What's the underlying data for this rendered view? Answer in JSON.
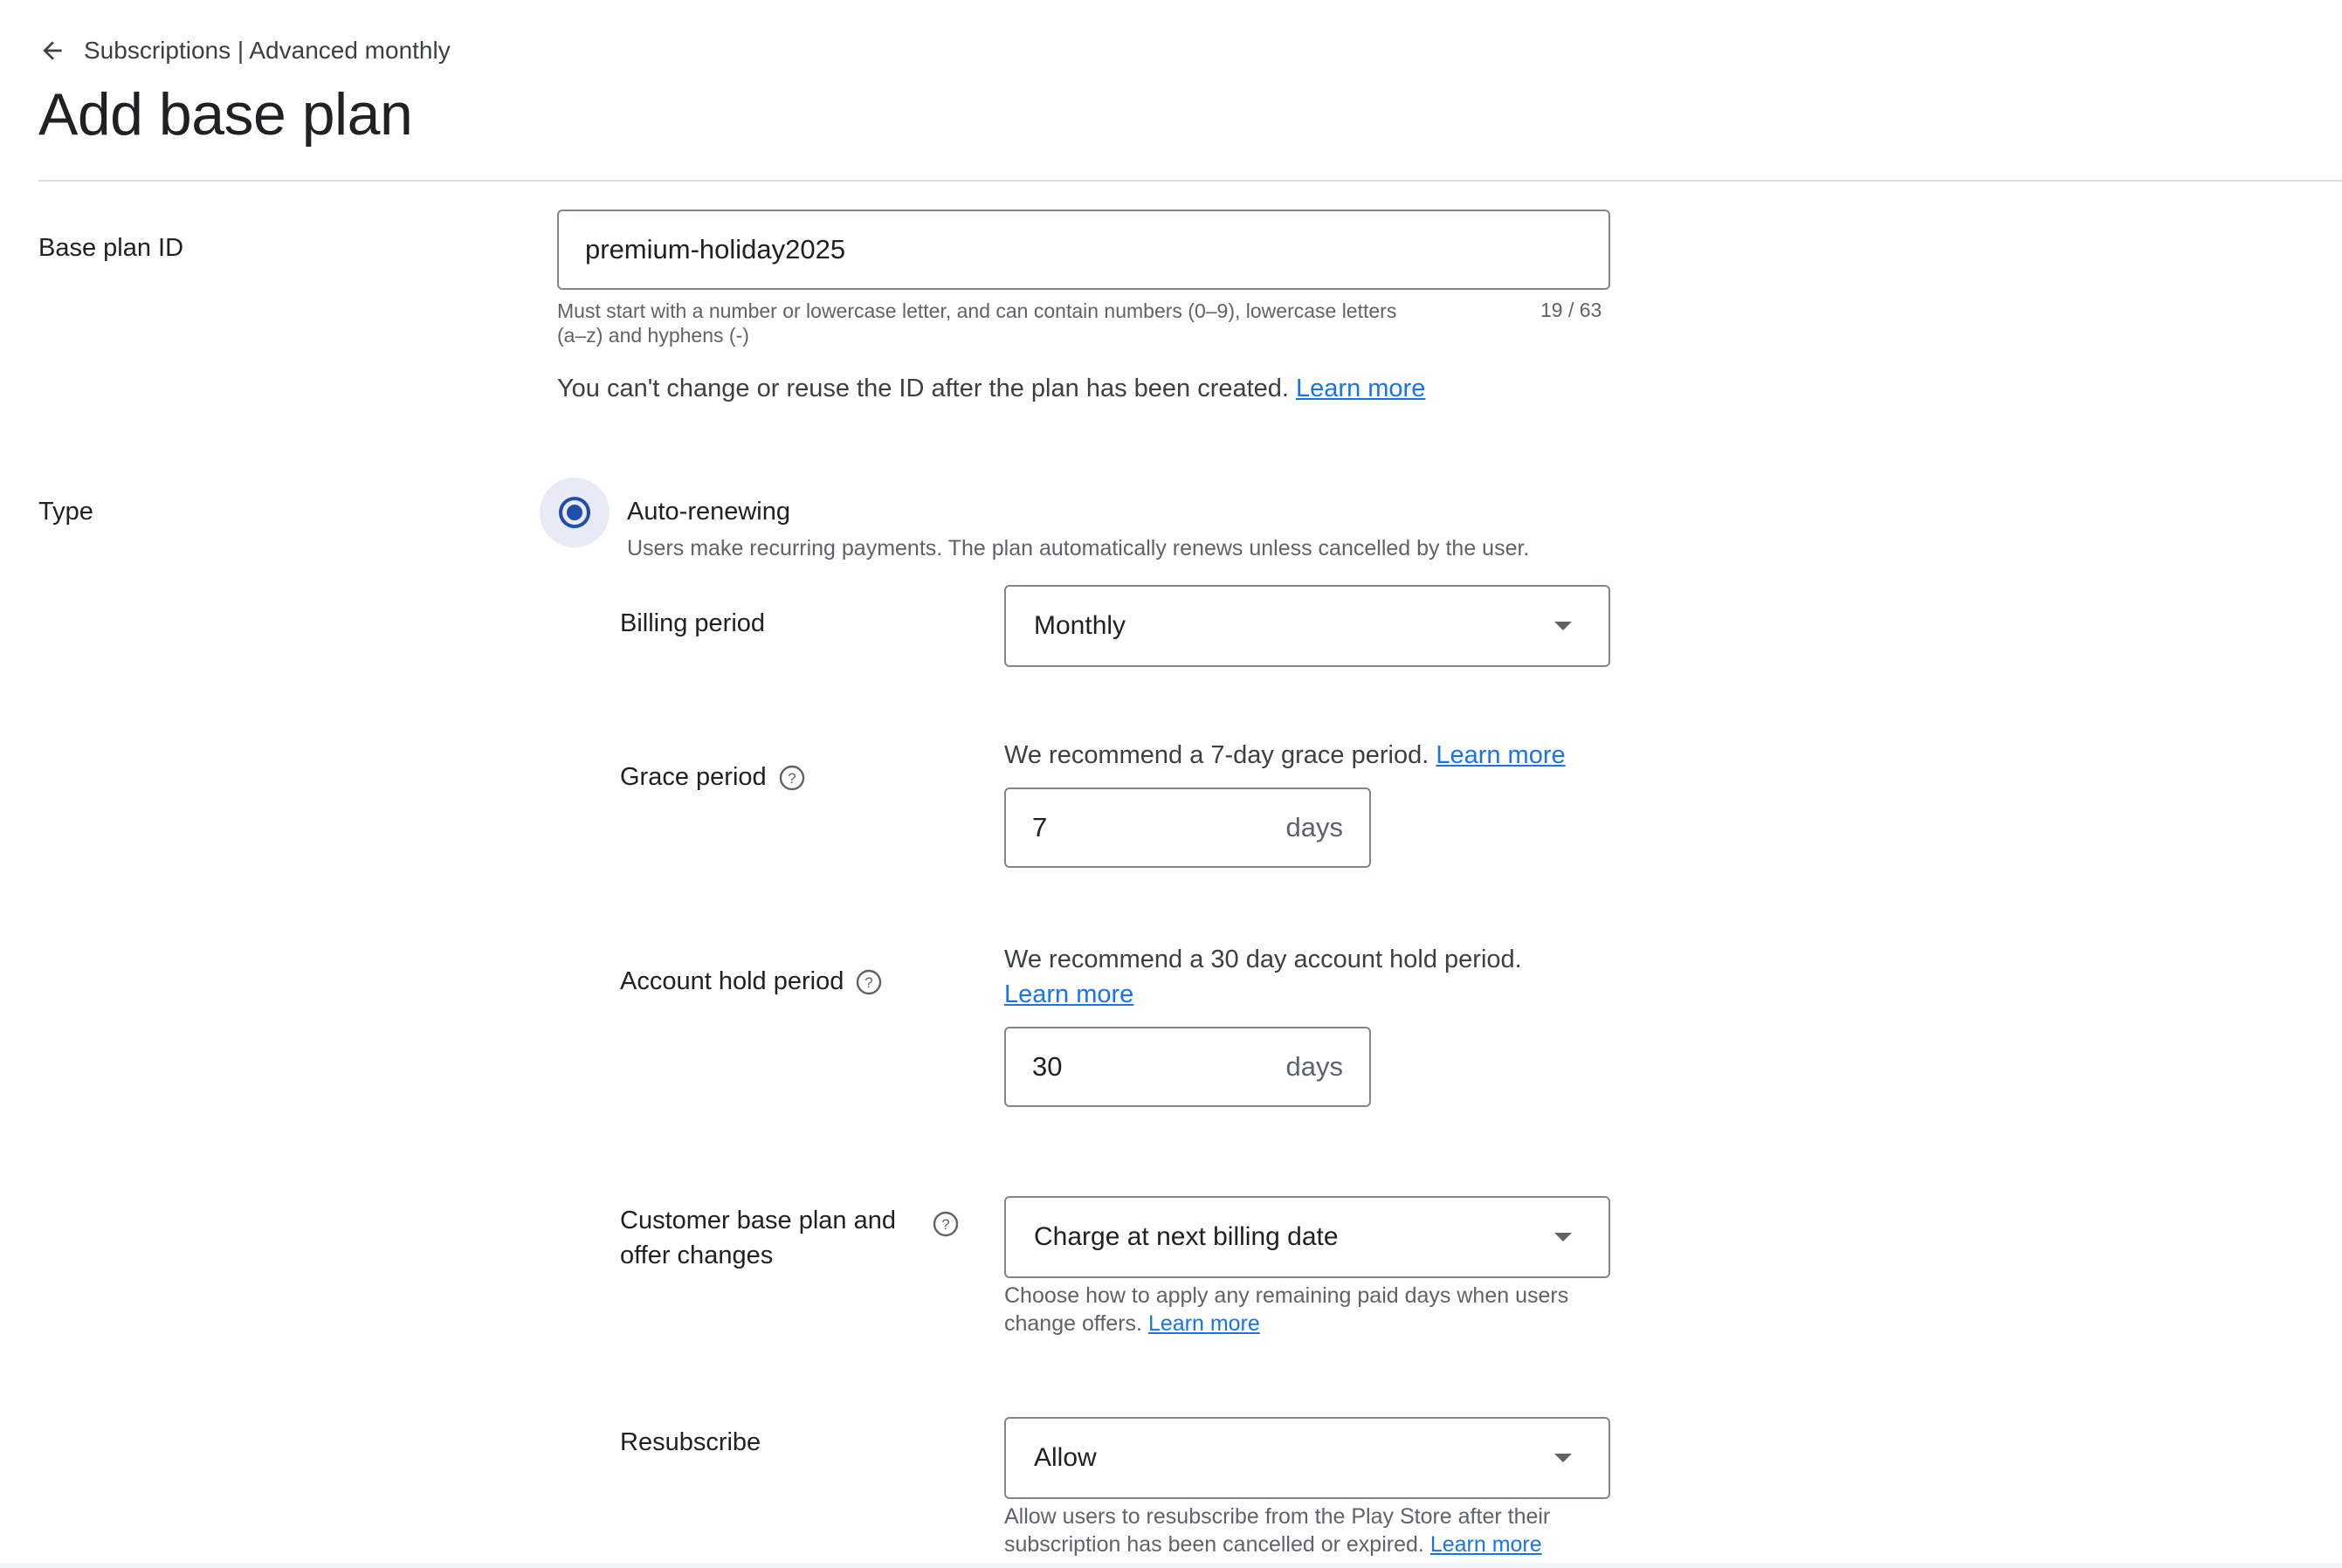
{
  "header": {
    "breadcrumb": "Subscriptions | Advanced monthly",
    "title": "Add base plan"
  },
  "base_plan_id": {
    "label": "Base plan ID",
    "value": "premium-holiday2025",
    "helper_line1": "Must start with a number or lowercase letter, and can contain numbers (0–9), lowercase letters",
    "helper_line2": "(a–z) and hyphens (-)",
    "counter": "19 / 63",
    "notice": "You can't change or reuse the ID after the plan has been created.",
    "learn_more": "Learn more"
  },
  "type": {
    "label": "Type",
    "option_label": "Auto-renewing",
    "option_selected": true,
    "option_description": "Users make recurring payments. The plan automatically renews unless cancelled by the user."
  },
  "billing_period": {
    "label": "Billing period",
    "selected": "Monthly"
  },
  "grace_period": {
    "label": "Grace period",
    "recommendation": "We recommend a 7-day grace period.",
    "learn_more": "Learn more",
    "value": "7",
    "unit": "days"
  },
  "account_hold": {
    "label": "Account hold period",
    "recommendation": "We recommend a 30 day account hold period.",
    "learn_more": "Learn more",
    "value": "30",
    "unit": "days"
  },
  "offer_changes": {
    "label_line1": "Customer base plan and",
    "label_line2": "offer changes",
    "selected": "Charge at next billing date",
    "helper_line1": "Choose how to apply any remaining paid days when users",
    "helper_line2": "change offers.",
    "learn_more": "Learn more"
  },
  "resubscribe": {
    "label": "Resubscribe",
    "selected": "Allow",
    "helper_line1": "Allow users to resubscribe from the Play Store after their",
    "helper_line2": "subscription has been cancelled or expired.",
    "learn_more": "Learn more"
  },
  "icons": {
    "back": "arrow-left-icon",
    "help": "help-circle-icon",
    "dropdown": "caret-down-icon"
  },
  "colors": {
    "link": "#1a73e8",
    "radio_selected": "#1f4fa8",
    "border": "#80868b",
    "divider": "#dadce0"
  }
}
